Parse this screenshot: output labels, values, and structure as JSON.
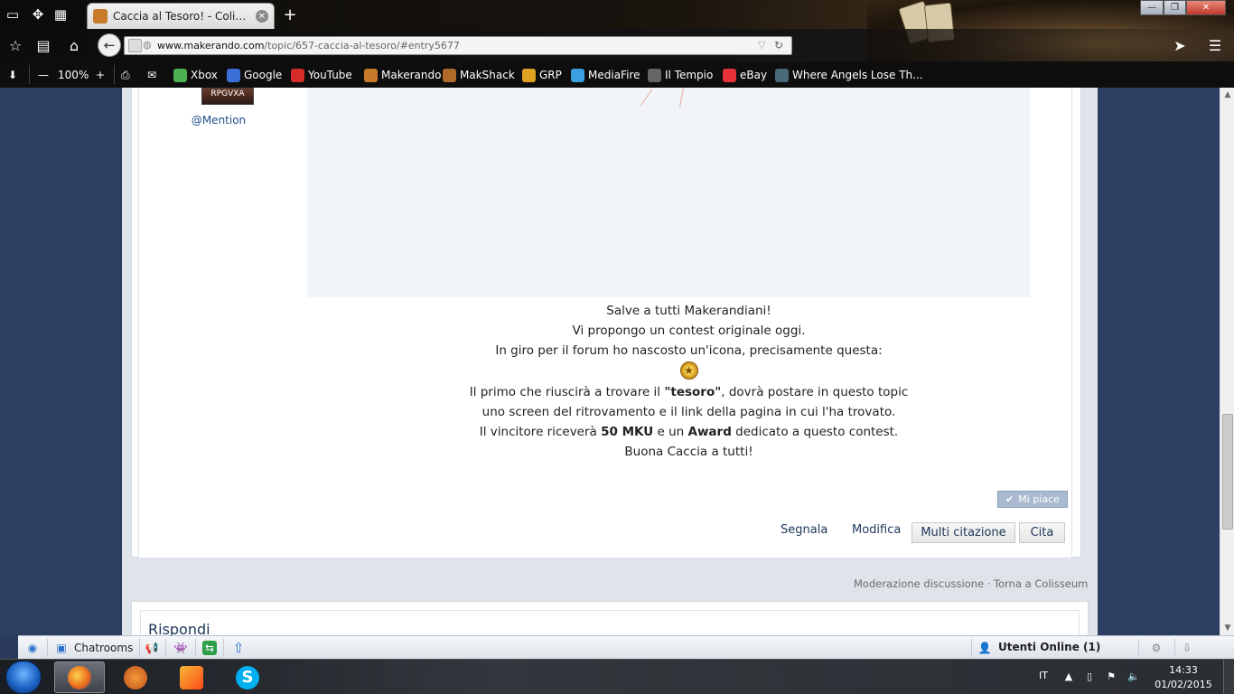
{
  "browser": {
    "tab_title": "Caccia al Tesoro! - Colisse...",
    "url_host": "www.makerando.com",
    "url_path": "/topic/657-caccia-al-tesoro/#entry5677",
    "zoom": "100%"
  },
  "bookmarks": [
    {
      "label": "Xbox",
      "color": "#4caf50"
    },
    {
      "label": "Google",
      "color": "#3b6fd8"
    },
    {
      "label": "YouTube",
      "color": "#d62b2b"
    },
    {
      "label": "Makerando",
      "color": "#c77a2a"
    },
    {
      "label": "MakShack",
      "color": "#b06a2a"
    },
    {
      "label": "GRP",
      "color": "#e0a020"
    },
    {
      "label": "MediaFire",
      "color": "#3aa0e0"
    },
    {
      "label": "Il Tempio",
      "color": "#666666"
    },
    {
      "label": "eBay",
      "color": "#e53238"
    },
    {
      "label": "Where Angels Lose Th...",
      "color": "#4a6a7a"
    }
  ],
  "post": {
    "author_badge": "RPGVXA",
    "mention": "@Mention",
    "lines": [
      "Salve a tutti Makerandiani!",
      "Vi propongo un contest originale oggi.",
      "In giro per il forum ho nascosto un'icona, precisamente questa:"
    ],
    "line4_a": "Il primo che riuscirà a trovare il ",
    "line4_b": "\"tesoro\"",
    "line4_c": ", dovrà postare in questo topic",
    "line5": "uno screen del ritrovamento e il link della pagina in cui l'ha trovato.",
    "line6_a": "Il vincitore riceverà ",
    "line6_b": "50 MKU",
    "line6_c": " e un ",
    "line6_d": "Award",
    "line6_e": " dedicato a questo contest.",
    "line7": "Buona Caccia a tutti!",
    "like_label": "Mi piace",
    "report_label": "Segnala",
    "edit_label": "Modifica",
    "multiquote_label": "Multi citazione",
    "quote_label": "Cita"
  },
  "moderation": {
    "mod_label": "Moderazione discussione",
    "separator": " · ",
    "back_label": "Torna a Colisseum"
  },
  "reply": {
    "title": "Rispondi"
  },
  "chatbar": {
    "chatrooms_label": "Chatrooms",
    "users_online_label": "Utenti Online (1)"
  },
  "taskbar": {
    "language": "IT",
    "time": "14:33",
    "date": "01/02/2015"
  }
}
